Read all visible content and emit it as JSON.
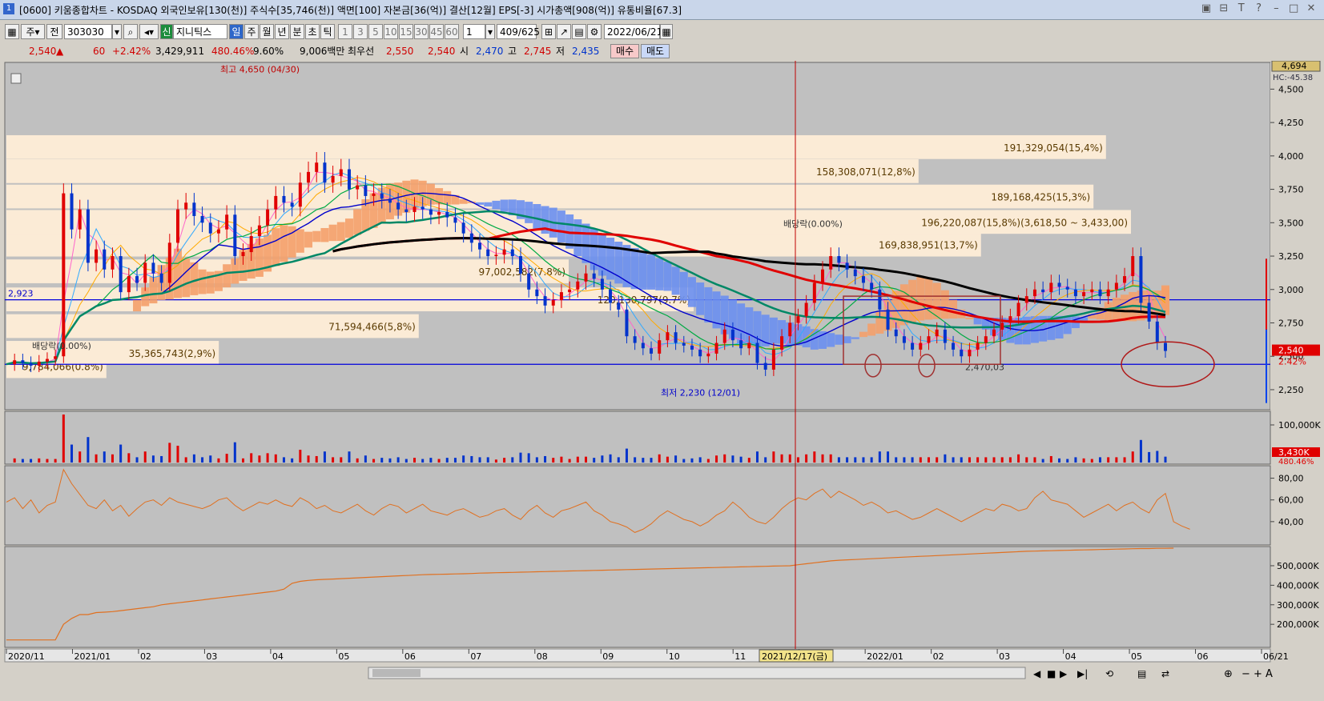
{
  "window": {
    "title": "[0600] 키움종합차트 - KOSDAQ 외국인보유[130(천)] 주식수[35,746(천)] 액면[100] 자본금[36(억)] 결산[12월] EPS[-3] 시가총액[908(억)] 유통비율[67.3]",
    "icon": "1",
    "buttons": [
      "restore-icon",
      "pin-icon",
      "font-icon",
      "help-icon",
      "minimize-icon",
      "maximize-icon",
      "close-icon"
    ]
  },
  "toolbar": {
    "period_select": "주",
    "prev_label": "전",
    "code": "303030",
    "brand": "신",
    "name": "지니틱스",
    "periods": [
      "일",
      "주",
      "월",
      "년",
      "분",
      "초",
      "틱"
    ],
    "numbers": [
      "1",
      "3",
      "5",
      "10",
      "15",
      "30",
      "45",
      "60"
    ],
    "count_value": "1",
    "paging": "409/625",
    "date": "2022/06/21"
  },
  "quote": {
    "price": "2,540",
    "change": "60",
    "change_pct": "+2.42%",
    "volume": "3,429,911",
    "volume_ratio": "480.46%",
    "turnover": "9.60%",
    "amount": "9,006백만",
    "best_label": "최우선",
    "best_ask": "2,550",
    "best_bid": "2,540",
    "open_label": "시",
    "open": "2,470",
    "high_label": "고",
    "high": "2,745",
    "low_label": "저",
    "low": "2,435",
    "buy_label": "매수",
    "sell_label": "매도"
  },
  "colors": {
    "price_up": "#d00000",
    "price_down": "#0033cc",
    "buy_bg": "#f7c9c9",
    "sell_bg": "#c9d8f7",
    "chart_bg": "#c0c0c0",
    "band_bg": "#fbebd6",
    "cloud_orange": "#f4a06a",
    "cloud_blue": "#6a8ff0"
  },
  "chart_data": [
    {
      "type": "candlestick",
      "title": "",
      "x_labels": [
        "2020/11",
        "2021/01",
        "02",
        "03",
        "04",
        "05",
        "06",
        "07",
        "08",
        "09",
        "10",
        "11",
        "12",
        "2022/01",
        "02",
        "03",
        "04",
        "05",
        "06",
        "06/21"
      ],
      "y_ticks": [
        4500,
        4250,
        4000,
        3750,
        3500,
        3250,
        3000,
        2750,
        2500,
        2250
      ],
      "ylim": [
        2100,
        4700
      ],
      "y_tick_labels": [
        "4,500",
        "4,250",
        "4,000",
        "3,750",
        "3,500",
        "3,250",
        "3,000",
        "2,750",
        "2,500",
        "2,250"
      ],
      "max_label": "4,694",
      "hc_label": "HC:-45.38",
      "current_price_label": "2,540",
      "current_pct_label": "2.42%",
      "cursor_date": "2021/12/17(금)",
      "level_left_label": "2,923",
      "annotations": {
        "high": "최고 4,650 (04/30)",
        "low": "최저 2,230 (12/01)",
        "dividend_1": "배당락(0.00%)",
        "dividend_2": "배당락(0.00%)",
        "support": "2,470,03"
      },
      "volume_profile": [
        {
          "label": "9,784,066(0.8%)",
          "price": 2420
        },
        {
          "label": "35,365,743(2,9%)",
          "price": 2520
        },
        {
          "label": "71,594,466(5,8%)",
          "price": 2720
        },
        {
          "label": "120,130,797(9.7%)",
          "price": 2920
        },
        {
          "label": "97,002,582(7.8%)",
          "price": 3130
        },
        {
          "label": "169,838,951(13,7%)",
          "price": 3330
        },
        {
          "label": "196,220,087(15,8%)(3,618,50 ~ 3,433,00)",
          "price": 3500
        },
        {
          "label": "189,168,425(15,3%)",
          "price": 3690
        },
        {
          "label": "158,308,071(12,8%)",
          "price": 3880
        },
        {
          "label": "191,329,054(15,4%)",
          "price": 4060
        }
      ],
      "series": [
        {
          "name": "",
          "values": [
            2440,
            2470,
            2450,
            2430,
            2460,
            2480,
            2500,
            3720,
            3450,
            3600,
            3200,
            3300,
            3150,
            3250,
            2980,
            3100,
            3050,
            3200,
            3120,
            3050,
            3350,
            3600,
            3650,
            3550,
            3500,
            3420,
            3450,
            3560,
            3250,
            3280,
            3400,
            3480,
            3600,
            3700,
            3650,
            3620,
            3800,
            3880,
            3950,
            3800,
            3850,
            3900,
            3750,
            3780,
            3700,
            3720,
            3680,
            3650,
            3600,
            3580,
            3620,
            3600,
            3560,
            3580,
            3540,
            3500,
            3420,
            3350,
            3300,
            3250,
            3260,
            3300,
            3250,
            3120,
            3000,
            2950,
            2880,
            2920,
            2980,
            3000,
            3060,
            3120,
            3080,
            3000,
            2900,
            2850,
            2650,
            2600,
            2560,
            2520,
            2620,
            2680,
            2600,
            2580,
            2550,
            2500,
            2520,
            2600,
            2700,
            2620,
            2560,
            2600,
            2450,
            2400,
            2550,
            2650,
            2750,
            2800,
            2900,
            3050,
            3150,
            3250,
            3200,
            3150,
            3100,
            3050,
            3000,
            2850,
            2700,
            2650,
            2600,
            2550,
            2600,
            2650,
            2700,
            2600,
            2550,
            2500,
            2550,
            2600,
            2650,
            2700,
            2750,
            2800,
            2900,
            2950,
            3000,
            2980,
            3050,
            3020,
            3000,
            2950,
            2980,
            3000,
            2950,
            3000,
            3050,
            3100,
            3250,
            2900,
            2760,
            2600,
            2540
          ]
        }
      ]
    },
    {
      "type": "bar",
      "title": "",
      "y_tick_labels": [
        "100,000K"
      ],
      "current_label": "3,430K",
      "current_pct": "480.46%"
    },
    {
      "type": "line",
      "title": "",
      "y_ticks": [
        80,
        60,
        40
      ],
      "y_tick_labels": [
        "80,00",
        "60,00",
        "40,00"
      ],
      "ylim": [
        20,
        90
      ],
      "series": [
        {
          "name": "",
          "values": [
            58,
            62,
            52,
            60,
            48,
            55,
            58,
            88,
            75,
            65,
            55,
            52,
            60,
            50,
            55,
            45,
            52,
            58,
            60,
            55,
            62,
            58,
            56,
            54,
            52,
            55,
            60,
            62,
            55,
            50,
            54,
            58,
            56,
            60,
            56,
            54,
            62,
            58,
            52,
            55,
            50,
            48,
            52,
            56,
            50,
            46,
            52,
            56,
            54,
            48,
            52,
            56,
            50,
            48,
            46,
            50,
            52,
            48,
            44,
            46,
            50,
            52,
            46,
            42,
            50,
            55,
            48,
            44,
            50,
            52,
            55,
            58,
            50,
            46,
            40,
            38,
            35,
            30,
            33,
            38,
            45,
            50,
            46,
            42,
            40,
            36,
            40,
            46,
            50,
            58,
            52,
            44,
            40,
            38,
            44,
            52,
            58,
            62,
            60,
            66,
            70,
            62,
            68,
            64,
            60,
            55,
            58,
            54,
            48,
            50,
            46,
            42,
            44,
            48,
            52,
            48,
            44,
            40,
            44,
            48,
            52,
            50,
            56,
            54,
            50,
            52,
            62,
            68,
            60,
            58,
            56,
            50,
            44,
            48,
            52,
            56,
            50,
            55,
            58,
            52,
            48,
            60,
            66,
            40,
            36,
            33
          ]
        }
      ]
    },
    {
      "type": "area",
      "title": "",
      "y_ticks": [
        500000,
        400000,
        300000,
        200000
      ],
      "y_tick_labels": [
        "500,000K",
        "400,000K",
        "300,000K",
        "200,000K"
      ],
      "ylim": [
        90000,
        590000
      ],
      "series": [
        {
          "name": "",
          "values": [
            120000,
            120000,
            120000,
            120000,
            120000,
            120000,
            120000,
            200000,
            230000,
            250000,
            250000,
            260000,
            262000,
            265000,
            270000,
            275000,
            280000,
            285000,
            290000,
            300000,
            305000,
            310000,
            315000,
            320000,
            325000,
            330000,
            335000,
            340000,
            345000,
            350000,
            355000,
            360000,
            365000,
            370000,
            380000,
            410000,
            420000,
            425000,
            428000,
            430000,
            432000,
            434000,
            436000,
            438000,
            440000,
            442000,
            444000,
            446000,
            448000,
            450000,
            452000,
            454000,
            455000,
            456000,
            457000,
            458000,
            459000,
            460000,
            462000,
            463000,
            464000,
            465000,
            466000,
            467000,
            468000,
            469000,
            470000,
            471000,
            472000,
            473000,
            474000,
            475000,
            476000,
            477000,
            478000,
            479000,
            480000,
            481000,
            482000,
            483000,
            484000,
            485000,
            486000,
            487000,
            488000,
            489000,
            490000,
            491000,
            492000,
            493000,
            494000,
            495000,
            496000,
            497000,
            498000,
            499000,
            500000,
            505000,
            510000,
            515000,
            520000,
            525000,
            528000,
            530000,
            532000,
            534000,
            536000,
            538000,
            540000,
            542000,
            544000,
            546000,
            548000,
            550000,
            552000,
            554000,
            556000,
            558000,
            560000,
            562000,
            564000,
            566000,
            568000,
            570000,
            572000,
            574000,
            575000,
            576000,
            577000,
            578000,
            579000,
            580000,
            581000,
            582000,
            583000,
            584000,
            585000,
            586000,
            587000,
            588000,
            588000,
            589000,
            589000,
            590000
          ]
        }
      ]
    }
  ]
}
